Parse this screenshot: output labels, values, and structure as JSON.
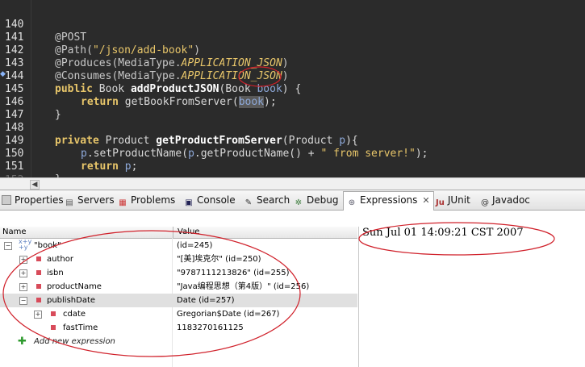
{
  "editor": {
    "line_numbers": [
      "140",
      "141",
      "142",
      "143",
      "144",
      "145",
      "146",
      "147",
      "148",
      "149",
      "150",
      "151"
    ],
    "lines": [
      {
        "annotation": "@POST"
      },
      {
        "annotation": "@Path(",
        "string": "\"/json/add-book\"",
        "tail": ")"
      },
      {
        "annotation": "@Produces(MediaType.",
        "constant": "APPLICATION_JSON",
        "tail": ")"
      },
      {
        "annotation": "@Consumes(MediaType.",
        "constant": "APPLICATION_JSON",
        "tail": ")"
      },
      {
        "kw1": "public",
        "type": " Book ",
        "method": "addProductJSON",
        "open": "(Book ",
        "param": "book",
        "close": ") {"
      },
      {
        "kw1": "return",
        "call": " getBookFromServer(",
        "arg": "book",
        "close": ");"
      },
      {
        "text": "}"
      },
      {
        "text": ""
      },
      {
        "kw1": "private",
        "type": " Product ",
        "method": "getProductFromServer",
        "open": "(Product ",
        "param": "p",
        "close": "){"
      },
      {
        "obj": "p",
        "call": ".setProductName(",
        "obj2": "p",
        "call2": ".getProductName() + ",
        "string": "\" from server!\"",
        "close": ");"
      },
      {
        "kw1": "return",
        "obj": " p",
        "close": ";"
      },
      {
        "text": "}"
      }
    ]
  },
  "tabs": [
    {
      "label": "Properties",
      "icon": "properties-icon"
    },
    {
      "label": "Servers",
      "icon": "servers-icon"
    },
    {
      "label": "Problems",
      "icon": "problems-icon"
    },
    {
      "label": "Console",
      "icon": "console-icon"
    },
    {
      "label": "Search",
      "icon": "search-icon"
    },
    {
      "label": "Debug",
      "icon": "debug-icon"
    },
    {
      "label": "Expressions",
      "icon": "expressions-icon",
      "active": true,
      "close": "✕"
    },
    {
      "label": "JUnit",
      "icon": "junit-icon",
      "icon_text": "Ju"
    },
    {
      "label": "Javadoc",
      "icon": "javadoc-icon",
      "icon_text": "@"
    }
  ],
  "table": {
    "headers": {
      "name": "Name",
      "value": "Value"
    },
    "rows": [
      {
        "name": "\"book\"",
        "value": "(id=245)",
        "level": 0,
        "expander": "−",
        "icon": "xy-icon"
      },
      {
        "name": "author",
        "value": "\"[美]埃克尔\" (id=250)",
        "level": 1,
        "expander": "+"
      },
      {
        "name": "isbn",
        "value": "\"9787111213826\" (id=255)",
        "level": 1,
        "expander": "+"
      },
      {
        "name": "productName",
        "value": "\"Java编程思想（第4版）\" (id=256)",
        "level": 1,
        "expander": "+"
      },
      {
        "name": "publishDate",
        "value": "Date  (id=257)",
        "level": 1,
        "expander": "−",
        "selected": true
      },
      {
        "name": "cdate",
        "value": "Gregorian$Date  (id=267)",
        "level": 2,
        "expander": "+"
      },
      {
        "name": "fastTime",
        "value": "1183270161125",
        "level": 2,
        "expander": ""
      }
    ],
    "add_expression": "Add new expression"
  },
  "detail": {
    "text": "Sun Jul 01 14:09:21 CST 2007"
  },
  "colors": {
    "annotation_red": "#d0202a",
    "editor_bg": "#2b2b2b",
    "field_icon": "#d84b5a"
  }
}
